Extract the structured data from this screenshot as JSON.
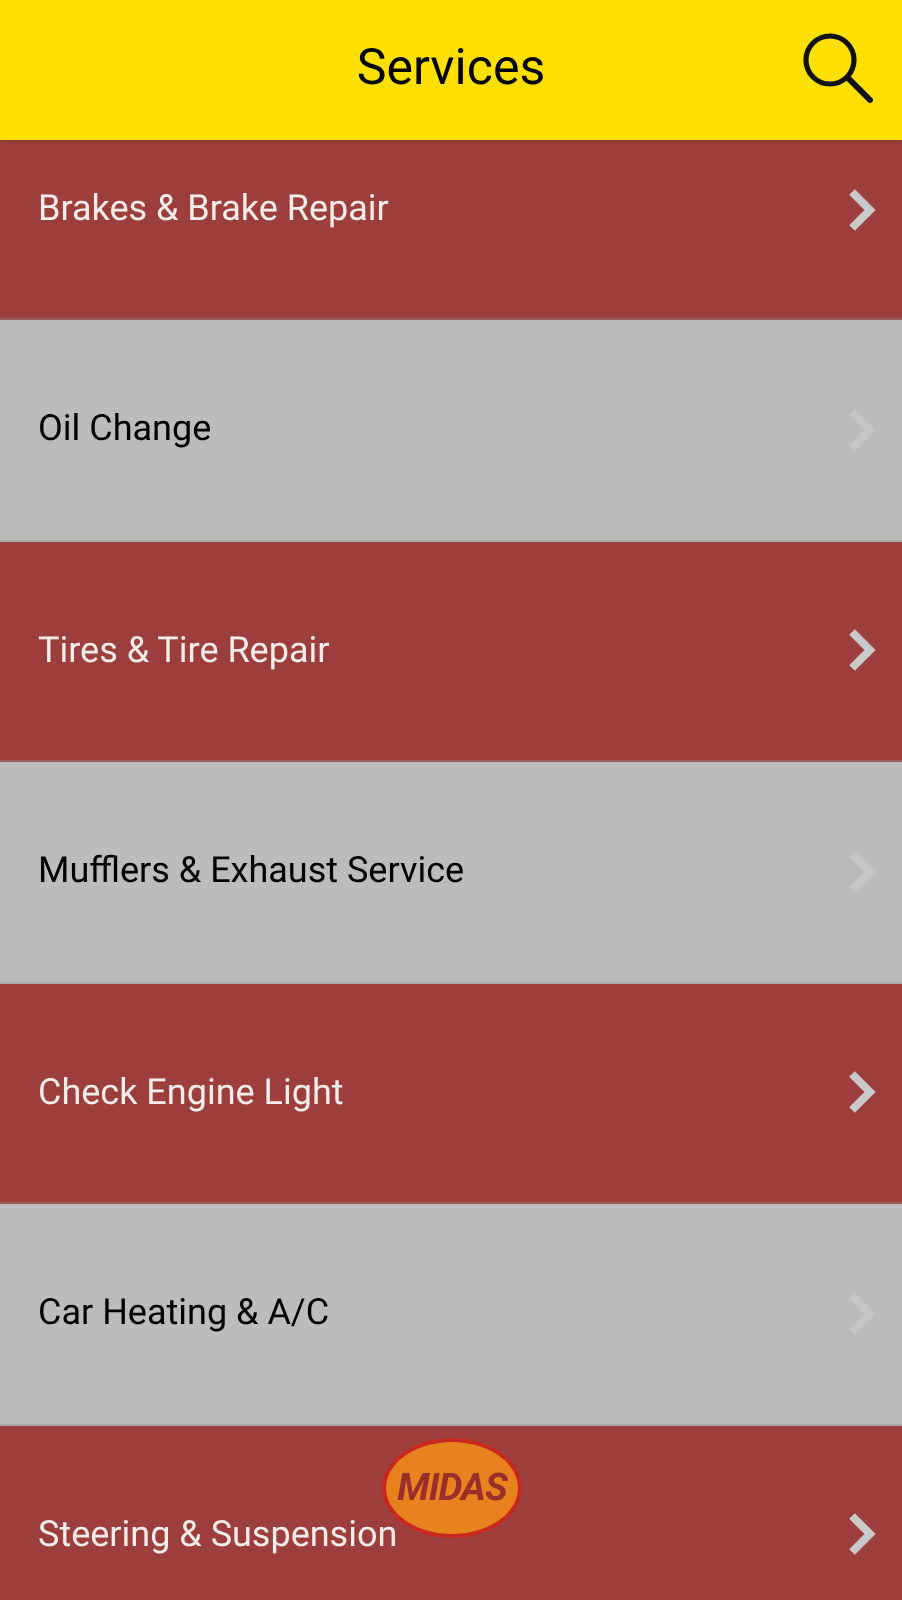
{
  "header": {
    "title": "Services"
  },
  "services": [
    {
      "label": "Brakes & Brake Repair",
      "kind": "dark"
    },
    {
      "label": "Oil Change",
      "kind": "light"
    },
    {
      "label": "Tires & Tire Repair",
      "kind": "dark"
    },
    {
      "label": "Mufflers & Exhaust Service",
      "kind": "light"
    },
    {
      "label": "Check Engine Light",
      "kind": "dark"
    },
    {
      "label": "Car Heating & A/C",
      "kind": "light"
    },
    {
      "label": "Steering & Suspension",
      "kind": "dark"
    }
  ],
  "logo": {
    "text": "MIDAS"
  }
}
